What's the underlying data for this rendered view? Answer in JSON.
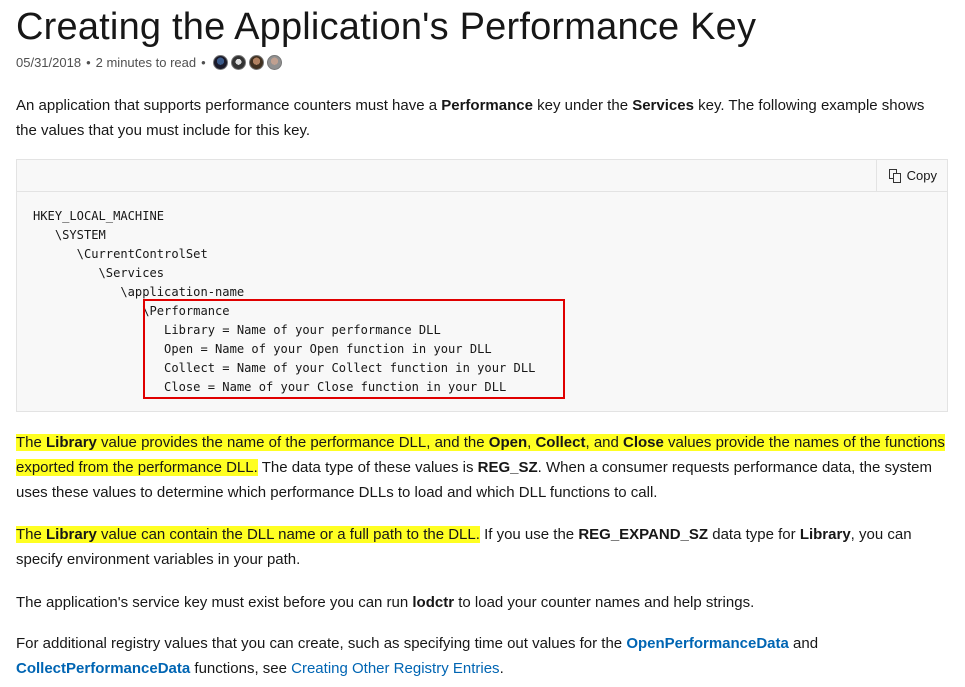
{
  "title": "Creating the Application's Performance Key",
  "meta": {
    "date": "05/31/2018",
    "separator": "•",
    "read_time": "2 minutes to read",
    "separator2": "•"
  },
  "p1": {
    "t1": "An application that supports performance counters must have a ",
    "b1": "Performance",
    "t2": " key under the ",
    "b2": "Services",
    "t3": " key. The following example shows the values that you must include for this key."
  },
  "code": {
    "copy_label": "Copy",
    "lines": [
      "HKEY_LOCAL_MACHINE",
      "   \\SYSTEM",
      "      \\CurrentControlSet",
      "         \\Services",
      "            \\application-name",
      "               \\Performance",
      "                  Library = Name of your performance DLL",
      "                  Open = Name of your Open function in your DLL",
      "                  Collect = Name of your Collect function in your DLL",
      "                  Close = Name of your Close function in your DLL"
    ]
  },
  "p2": {
    "t1": "The ",
    "b1": "Library",
    "t2": " value provides the name of the performance DLL, and the ",
    "b2": "Open",
    "t3": ", ",
    "b3": "Collect",
    "t4": ", and ",
    "b4": "Close",
    "t5": " values provide the names of the functions exported from the performance DLL.",
    "t6": " The data type of these values is ",
    "b5": "REG_SZ",
    "t7": ". When a consumer requests performance data, the system uses these values to determine which performance DLLs to load and which DLL functions to call."
  },
  "p3": {
    "t1": "The ",
    "b1": "Library",
    "t2": " value can contain the DLL name or a full path to the DLL.",
    "t3": " If you use the ",
    "b2": "REG_EXPAND_SZ",
    "t4": " data type for ",
    "b3": "Library",
    "t5": ", you can specify environment variables in your path."
  },
  "p4": {
    "t1": "The application's service key must exist before you can run ",
    "b1": "lodctr",
    "t2": " to load your counter names and help strings."
  },
  "p5": {
    "t1": "For additional registry values that you can create, such as specifying time out values for the ",
    "link1": "OpenPerformanceData",
    "t2": " and ",
    "link2": "CollectPerformanceData",
    "t3": " functions, see ",
    "link3": "Creating Other Registry Entries",
    "t4": "."
  },
  "colors": {
    "highlight": "#ffff22",
    "link": "#0065b3",
    "annotation_box": "#e00000"
  }
}
